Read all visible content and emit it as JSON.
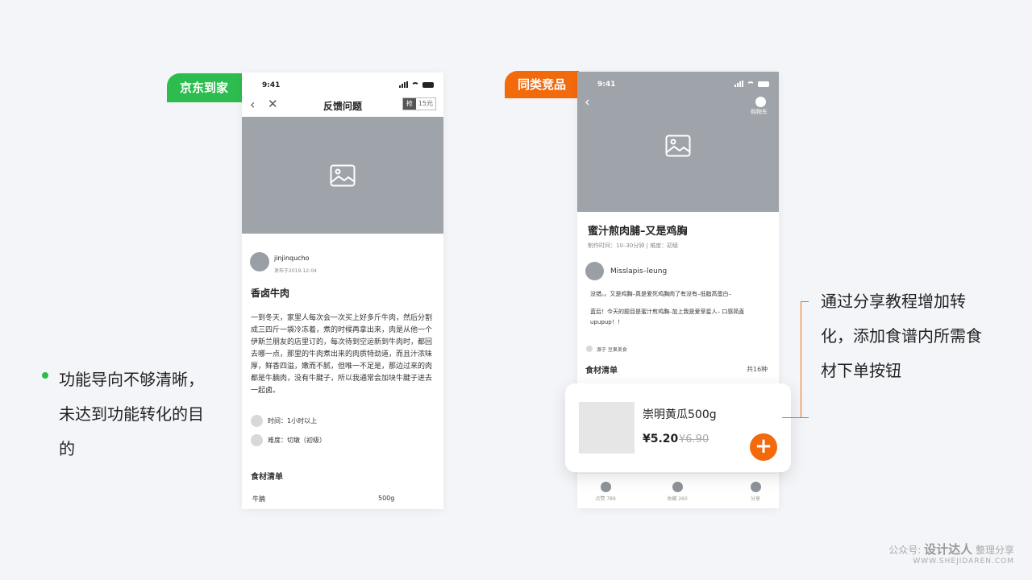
{
  "left_tag": "京东到家",
  "right_tag": "同类竞品",
  "phone1": {
    "time": "9:41",
    "nav_title": "反馈问题",
    "chip_a": "抢",
    "chip_b": "15元",
    "username": "jinjinqucho",
    "date": "发布于2019-12-04",
    "recipe_title": "香卤牛肉",
    "body": "一到冬天，家里人每次会一次买上好多斤牛肉，然后分割成三四斤一袋冷冻着，煮的时候再拿出来，肉是从他一个伊斯兰朋友的店里订的，每次待到空运新到牛肉时，都回去哪一点，那里的牛肉煮出来的肉质特劲道，而且汁浓味厚，鲜香四溢，嫩而不腻，但唯一不足是，那边过来的肉都是牛腩肉，没有牛腱子，所以我通常会加块牛腱子进去一起卤。",
    "time_label": "时间：1小时以上",
    "difficulty_label": "难度：切墩（初级）",
    "ingredients_title": "食材清单",
    "ingredient_name": "牛腩",
    "ingredient_qty": "500g"
  },
  "phone2": {
    "time": "9:41",
    "cart_label": "购物车",
    "recipe_title": "蜜汁煎肉脯–又是鸡胸",
    "meta": "制作时间：10–30分钟 | 难度：初级",
    "username": "Misslapis–leung",
    "text1": "没错。。又是鸡胸–真是爱死鸡胸肉了有没有–低脂高蛋白–",
    "text2": "蓝后！今天的题目是蜜汁煎鸡胸–加上我是爱菲星人– 口感简直upupup！！",
    "source": "源于 豆果美食",
    "ingredients_title": "食材清单",
    "ingredients_count": "共16种",
    "tabs": [
      "点赞 789",
      "收藏 260",
      "分享"
    ]
  },
  "product_card": {
    "name": "崇明黄瓜500g",
    "price": "¥5.20",
    "old_price": "¥6.90",
    "add_symbol": "+"
  },
  "note_left": "功能导向不够清晰，未达到功能转化的目的",
  "note_right": "通过分享教程增加转化，添加食谱内所需食材下单按钮",
  "watermark": {
    "prefix": "公众号: ",
    "brand": "设计达人",
    "suffix": " 整理分享",
    "url": "WWW.SHEJIDAREN.COM"
  },
  "colors": {
    "green": "#2dbd4e",
    "orange": "#f26a0c",
    "placeholder": "#9fa3aa"
  }
}
